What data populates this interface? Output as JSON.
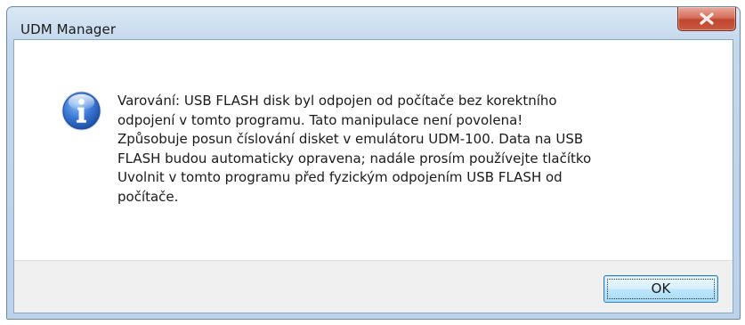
{
  "window": {
    "title": "UDM Manager"
  },
  "dialog": {
    "icon": "info-icon",
    "message": "Varování: USB FLASH disk byl odpojen od počítače bez korektního\nodpojení v tomto programu. Tato manipulace není povolena!\nZpůsobuje posun číslování disket v emulátoru UDM-100. Data na USB\nFLASH budou automaticky opravena; nadále prosím používejte tlačítko\nUvolnit v tomto programu před fyzickým odpojením USB FLASH od\npočítače."
  },
  "buttons": {
    "ok_label": "OK",
    "close_icon": "close-icon"
  },
  "colors": {
    "title_bar": "#c4d8ec",
    "close_button": "#c2462f",
    "footer": "#f0f0f0",
    "ok_button": "#bee6fd",
    "info_icon": "#2a64c5"
  }
}
